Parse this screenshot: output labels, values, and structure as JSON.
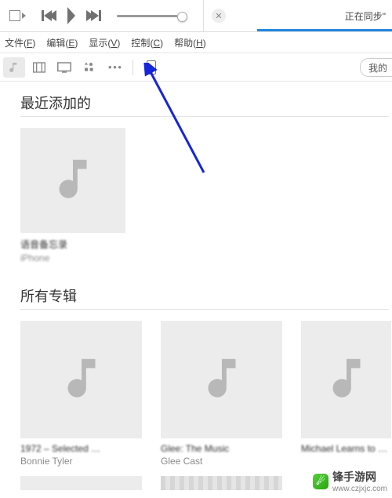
{
  "topbar": {
    "sync_label": "正在同步\"",
    "close_glyph": "✕"
  },
  "menu": {
    "file": "文件",
    "file_key": "F",
    "edit": "编辑",
    "edit_key": "E",
    "view": "显示",
    "view_key": "V",
    "control": "控制",
    "control_key": "C",
    "help": "帮助",
    "help_key": "H"
  },
  "toolbar": {
    "my_label": "我的",
    "more_glyph": "• • •"
  },
  "sections": {
    "recent_title": "最近添加的",
    "all_title": "所有专辑"
  },
  "recent": [
    {
      "title": "语音备忘录",
      "sub": "iPhone"
    }
  ],
  "albums": [
    {
      "title": "1972 – Selected …",
      "sub": "Bonnie Tyler"
    },
    {
      "title": "Glee: The Music",
      "sub": "Glee Cast"
    },
    {
      "title": "Michael Learns to Roc",
      "sub": ""
    }
  ],
  "watermark": {
    "label": "锋手游网",
    "url": "www.czjxjc.com",
    "badge_glyph": "☄"
  }
}
